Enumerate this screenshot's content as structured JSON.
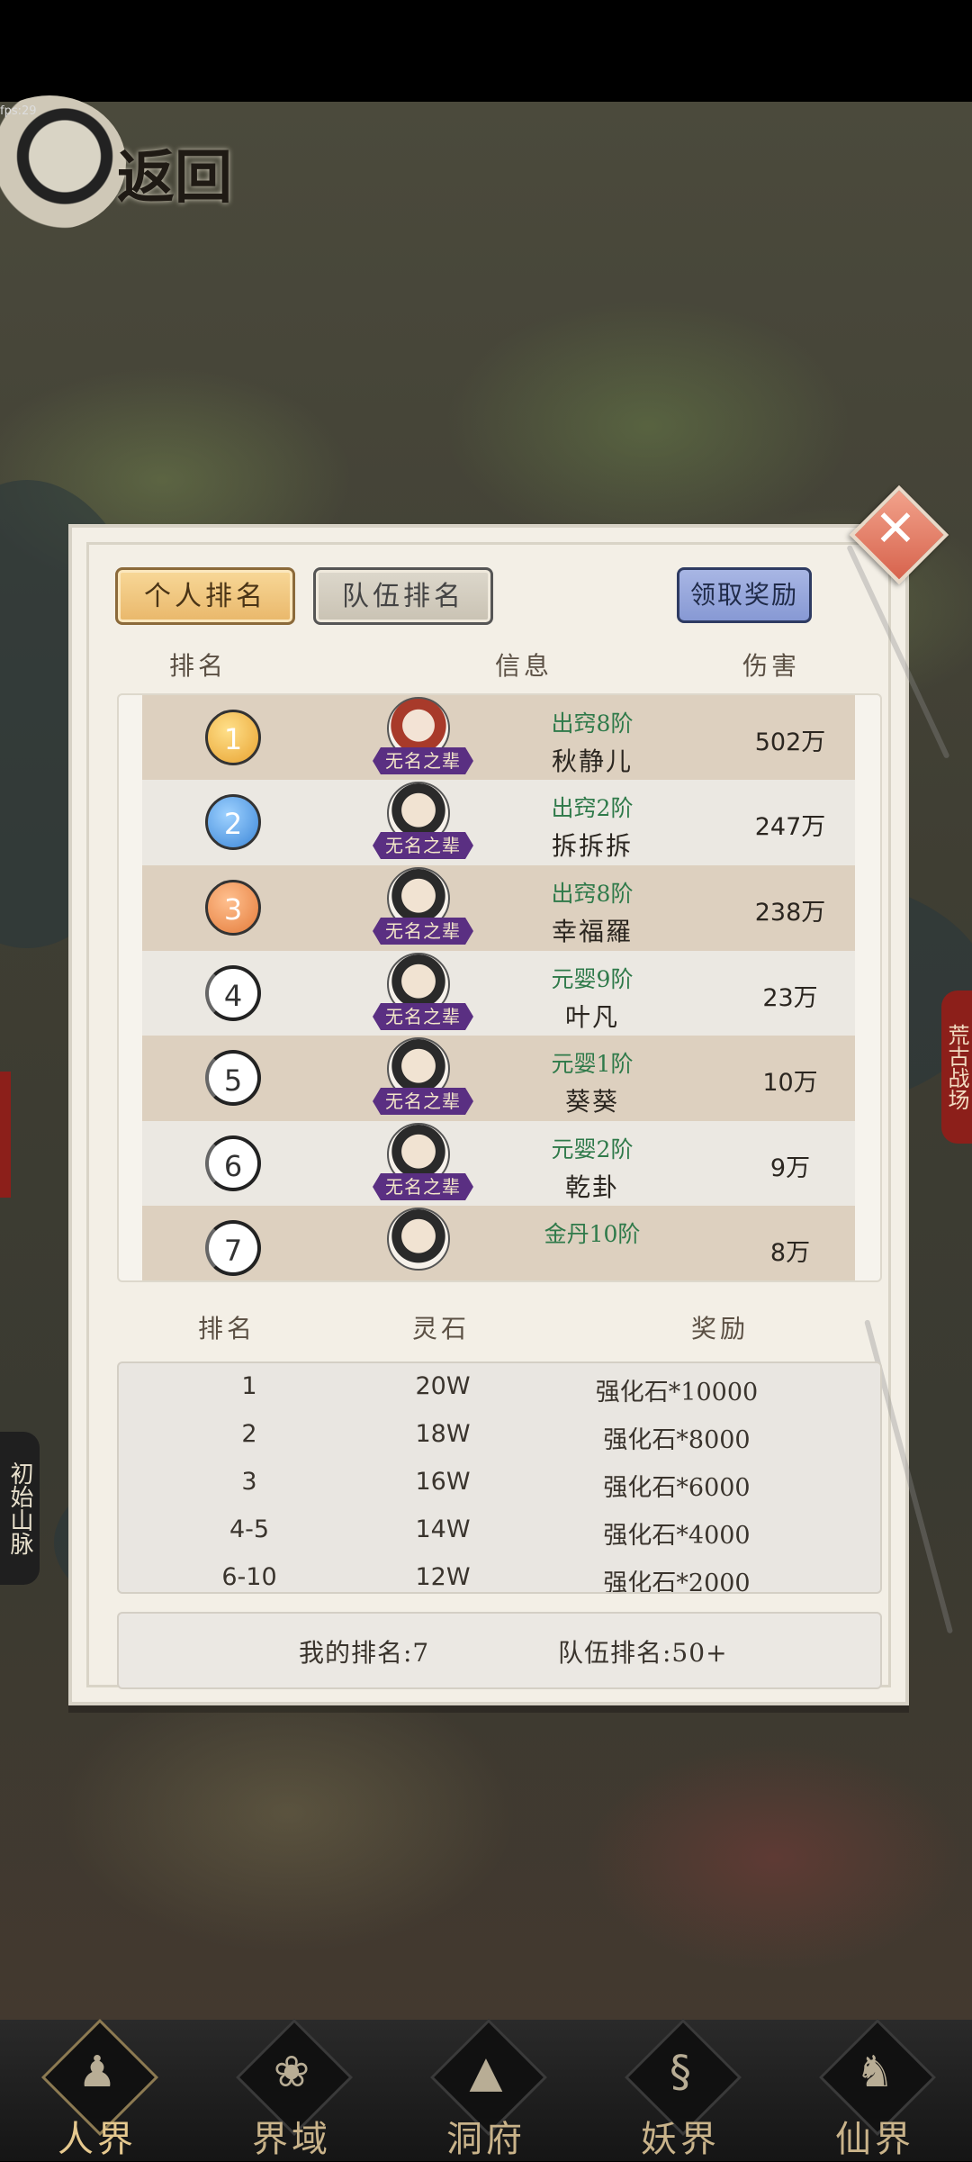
{
  "status": {
    "fps": "fps:29"
  },
  "header": {
    "back_label": "返回"
  },
  "side": {
    "left_label": "初始山脉",
    "right_label": "荒古战场"
  },
  "dialog": {
    "tabs": {
      "personal": "个人排名",
      "team": "队伍排名"
    },
    "claim_button": "领取奖励",
    "rank_headers": {
      "rank": "排名",
      "info": "信息",
      "damage": "伤害"
    },
    "rows": [
      {
        "rank": "1",
        "title": "无名之辈",
        "realm": "出窍8阶",
        "name": "秋静儿",
        "damage": "502万"
      },
      {
        "rank": "2",
        "title": "无名之辈",
        "realm": "出窍2阶",
        "name": "拆拆拆",
        "damage": "247万"
      },
      {
        "rank": "3",
        "title": "无名之辈",
        "realm": "出窍8阶",
        "name": "幸福羅",
        "damage": "238万"
      },
      {
        "rank": "4",
        "title": "无名之辈",
        "realm": "元婴9阶",
        "name": "叶凡",
        "damage": "23万"
      },
      {
        "rank": "5",
        "title": "无名之辈",
        "realm": "元婴1阶",
        "name": "葵葵",
        "damage": "10万"
      },
      {
        "rank": "6",
        "title": "无名之辈",
        "realm": "元婴2阶",
        "name": "乾卦",
        "damage": "9万"
      },
      {
        "rank": "7",
        "title": "",
        "realm": "金丹10阶",
        "name": "",
        "damage": "8万"
      }
    ],
    "reward_headers": {
      "rank": "排名",
      "stone": "灵石",
      "reward": "奖励"
    },
    "rewards": [
      {
        "rank": "1",
        "stone": "20W",
        "reward": "强化石*10000"
      },
      {
        "rank": "2",
        "stone": "18W",
        "reward": "强化石*8000"
      },
      {
        "rank": "3",
        "stone": "16W",
        "reward": "强化石*6000"
      },
      {
        "rank": "4-5",
        "stone": "14W",
        "reward": "强化石*4000"
      },
      {
        "rank": "6-10",
        "stone": "12W",
        "reward": "强化石*2000"
      }
    ],
    "my_rank": "我的排名:7",
    "team_rank": "队伍排名:50+"
  },
  "nav": [
    {
      "label": "人界",
      "icon": "person-icon",
      "active": true
    },
    {
      "label": "界域",
      "icon": "lotus-icon",
      "active": false
    },
    {
      "label": "洞府",
      "icon": "mountain-icon",
      "active": false
    },
    {
      "label": "妖界",
      "icon": "serpent-icon",
      "active": false
    },
    {
      "label": "仙界",
      "icon": "immortal-icon",
      "active": false
    }
  ]
}
